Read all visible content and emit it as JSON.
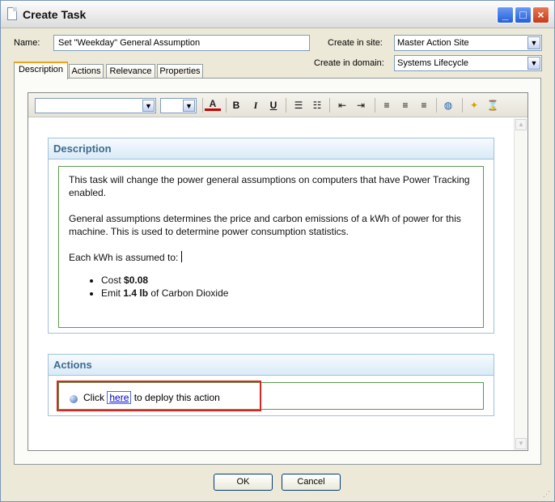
{
  "window": {
    "title": "Create Task"
  },
  "form": {
    "name_label": "Name:",
    "name_value": "Set \"Weekday\" General Assumption",
    "site_label": "Create in site:",
    "site_value": "Master Action Site",
    "domain_label": "Create in domain:",
    "domain_value": "Systems Lifecycle"
  },
  "tabs": [
    {
      "label": "Description",
      "active": true
    },
    {
      "label": "Actions",
      "active": false
    },
    {
      "label": "Relevance",
      "active": false
    },
    {
      "label": "Properties",
      "active": false
    }
  ],
  "toolbar": {
    "font_family": "",
    "font_size": "",
    "bold_label": "B",
    "italic_label": "I",
    "underline_label": "U",
    "icons": [
      "font-color-icon",
      "bold-icon",
      "italic-icon",
      "underline-icon",
      "numbered-list-icon",
      "bullet-list-icon",
      "outdent-icon",
      "indent-icon",
      "align-left-icon",
      "align-center-icon",
      "align-right-icon",
      "insert-link-icon",
      "wand-icon",
      "hourglass-icon"
    ]
  },
  "description": {
    "heading": "Description",
    "para1": "This task will change the power general assumptions on computers that have Power Tracking enabled.",
    "para2": "General assumptions determines the price and carbon emissions of a kWh of power for this machine. This is used to determine power consumption statistics.",
    "para3": "Each kWh is assumed to:",
    "items": [
      {
        "prefix": "Cost",
        "bold": "$0.08",
        "suffix": ""
      },
      {
        "prefix": "Emit",
        "bold": "1.4 lb",
        "suffix": "of Carbon Dioxide"
      }
    ]
  },
  "actions": {
    "heading": "Actions",
    "click_text": "Click",
    "link_text": "here",
    "after_text": "to deploy this action"
  },
  "buttons": {
    "ok": "OK",
    "cancel": "Cancel"
  },
  "colors": {
    "panel_header_text": "#3f6b8f",
    "inner_border": "#5a9b4f",
    "highlight_box": "#e02424",
    "link": "#0000cc"
  }
}
